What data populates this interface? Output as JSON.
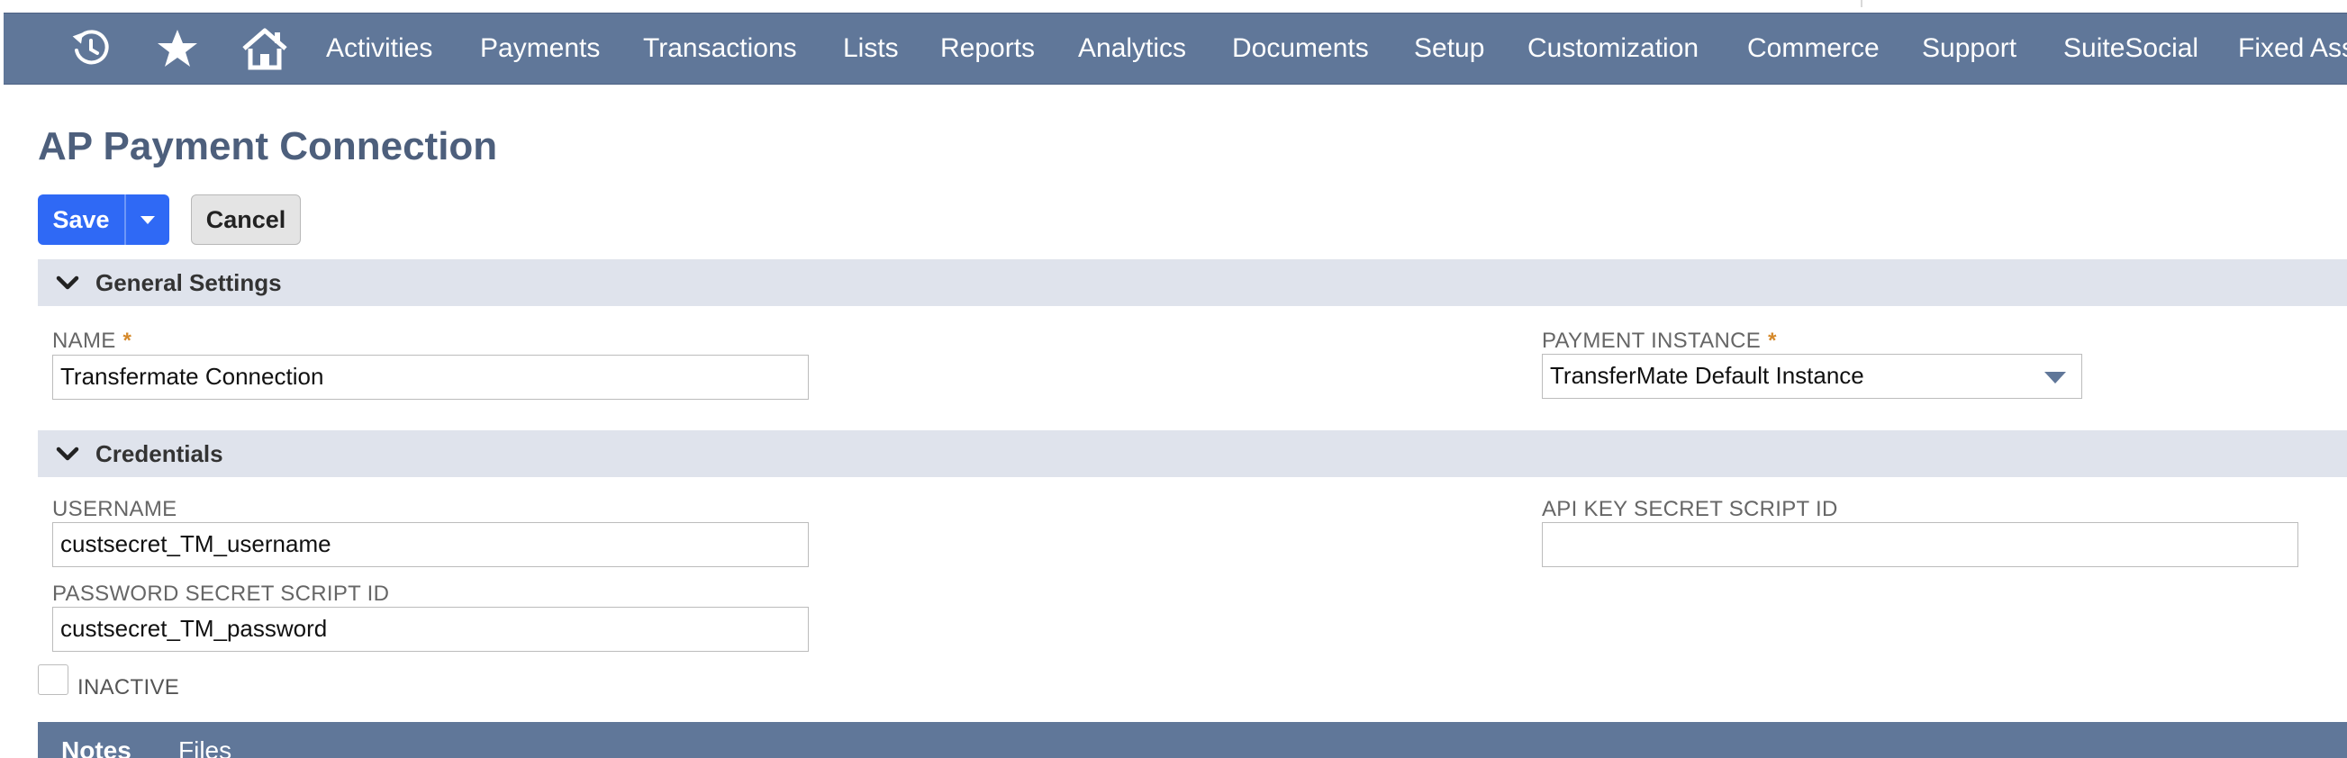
{
  "nav": {
    "icons": [
      "recent-records-icon",
      "star-icon",
      "home-icon"
    ],
    "items": [
      "Activities",
      "Payments",
      "Transactions",
      "Lists",
      "Reports",
      "Analytics",
      "Documents",
      "Setup",
      "Customization",
      "Commerce",
      "Support",
      "SuiteSocial",
      "Fixed Ass"
    ]
  },
  "page": {
    "title": "AP Payment Connection"
  },
  "actions": {
    "save_label": "Save",
    "cancel_label": "Cancel"
  },
  "sections": {
    "general": {
      "title": "General Settings",
      "name_label": "NAME",
      "name_value": "Transfermate Connection",
      "payment_instance_label": "PAYMENT INSTANCE",
      "payment_instance_value": "TransferMate Default Instance"
    },
    "credentials": {
      "title": "Credentials",
      "username_label": "USERNAME",
      "username_value": "custsecret_TM_username",
      "password_label": "PASSWORD SECRET SCRIPT ID",
      "password_value": "custsecret_TM_password",
      "api_key_label": "API KEY SECRET SCRIPT ID",
      "api_key_value": ""
    }
  },
  "inactive": {
    "label": "INACTIVE",
    "checked": false
  },
  "required_marker": "*",
  "subtabs": [
    "Notes",
    "Files"
  ],
  "colors": {
    "navbar": "#607799",
    "save_button": "#2f69f5",
    "title": "#4d5f7c",
    "section_bar": "#dfe3ec",
    "required": "#d5892a"
  }
}
